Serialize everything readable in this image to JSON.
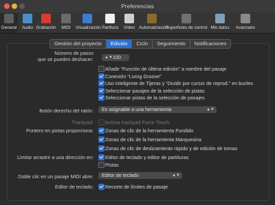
{
  "window": {
    "title": "Preferencias"
  },
  "toolbar": [
    {
      "name": "general",
      "label": "General",
      "color": "#5f5f5f"
    },
    {
      "name": "audio",
      "label": "Audio",
      "color": "#4a8ec9"
    },
    {
      "name": "recording",
      "label": "Grabación",
      "color": "#d63b34"
    },
    {
      "name": "midi",
      "label": "MIDI",
      "color": "#6b6b6b"
    },
    {
      "name": "display",
      "label": "Visualización",
      "color": "#3b7ed0"
    },
    {
      "name": "score",
      "label": "Partitura",
      "color": "#f0f0f0"
    },
    {
      "name": "video",
      "label": "Vídeo",
      "color": "#cfcfcf"
    },
    {
      "name": "automation",
      "label": "Automatización",
      "color": "#8a6a2a"
    },
    {
      "name": "control-surfaces",
      "label": "Superficies de control",
      "color": "#707070"
    },
    {
      "name": "my-info",
      "label": "Mis datos",
      "color": "#7f9fb8"
    },
    {
      "name": "advanced",
      "label": "Avanzado",
      "color": "#8a8a8a"
    }
  ],
  "tabs": [
    "Gestión del proyecto",
    "Edición",
    "Ciclo",
    "Seguimiento",
    "Notificaciones"
  ],
  "active_tab": "Edición",
  "undo": {
    "label_line1": "Número de pasos",
    "label_line2": "que se pueden deshacer:",
    "value": "100"
  },
  "checks": [
    {
      "label": "Añadir “Función de última edición” a nombre del pasaje",
      "checked": false
    },
    {
      "label": "Conexión “Living Groove”",
      "checked": true
    },
    {
      "label": "Uso inteligente de Tijeras y “Dividir por cursor de reprod.” en bucles",
      "checked": true
    },
    {
      "label": "Seleccionar pasajes de la selección de pistas",
      "checked": true
    },
    {
      "label": "Seleccionar pistas de la selección de pasajes",
      "checked": true
    }
  ],
  "right_click": {
    "label": "Botón derecho del ratón:",
    "value": "Es asignable a una herramienta"
  },
  "trackpad": {
    "label": "Trackpad:",
    "option": "Activar trackpad Force Touch",
    "checked": false
  },
  "pointer": {
    "label": "Puntero en pistas proporciona:",
    "options": [
      {
        "label": "Zonas de clic de la herramienta Fundido",
        "checked": true
      },
      {
        "label": "Zonas de clic de la herramienta Marquesina",
        "checked": true
      },
      {
        "label": "Zonas de clic de deslizamiento rápido y de edición de tomas",
        "checked": true
      }
    ]
  },
  "limit_drag": {
    "label": "Limitar arrastre a una dirección en:",
    "options": [
      {
        "label": "Editor de teclado y editor de partituras",
        "checked": true
      },
      {
        "label": "Pistas",
        "checked": false
      }
    ]
  },
  "midi_double_click": {
    "label": "Doble clic en un pasaje MIDI abre:",
    "value": "Editor de teclado"
  },
  "keyboard_editor": {
    "label": "Editor de teclado:",
    "option": "Recorte de límites de pasaje",
    "checked": true
  }
}
